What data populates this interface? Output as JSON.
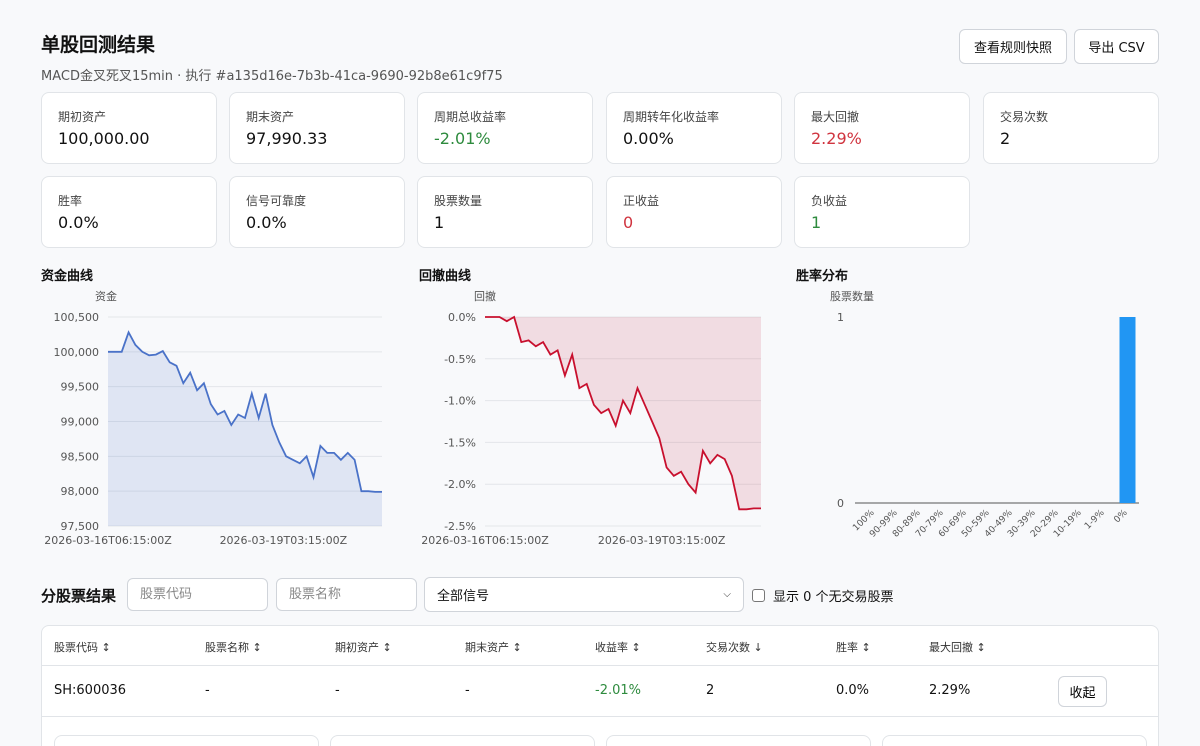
{
  "header": {
    "title": "单股回测结果",
    "subtitle": "MACD金叉死叉15min · 执行 #a135d16e-7b3b-41ca-9690-92b8e61c9f75"
  },
  "toolbar": {
    "rules_label": "查看规则快照",
    "csv_label": "导出 CSV"
  },
  "metrics": [
    {
      "label": "期初资产",
      "value": "100,000.00",
      "color": "#111111"
    },
    {
      "label": "期末资产",
      "value": "97,990.33",
      "color": "#111111"
    },
    {
      "label": "周期总收益率",
      "value": "-2.01%",
      "color": "#2e8b3e"
    },
    {
      "label": "周期转年化收益率",
      "value": "0.00%",
      "color": "#111111"
    },
    {
      "label": "最大回撤",
      "value": "2.29%",
      "color": "#d0343f"
    },
    {
      "label": "交易次数",
      "value": "2",
      "color": "#111111"
    },
    {
      "label": "胜率",
      "value": "0.0%",
      "color": "#111111"
    },
    {
      "label": "信号可靠度",
      "value": "0.0%",
      "color": "#111111"
    },
    {
      "label": "股票数量",
      "value": "1",
      "color": "#111111"
    },
    {
      "label": "正收益",
      "value": "0",
      "color": "#d0343f"
    },
    {
      "label": "负收益",
      "value": "1",
      "color": "#2e8b3e"
    }
  ],
  "charts": {
    "equity": {
      "title": "资金曲线"
    },
    "drawdown": {
      "title": "回撤曲线"
    },
    "winrate": {
      "title": "胜率分布"
    }
  },
  "chart_data": [
    {
      "type": "area",
      "title": "资金曲线",
      "ylabel": "资金",
      "ylim": [
        97500,
        100500
      ],
      "yticks": [
        "100,500",
        "100,000",
        "99,500",
        "99,000",
        "98,500",
        "98,000",
        "97,500"
      ],
      "xticks": [
        "2026-03-16T06:15:00Z",
        "2026-03-19T03:15:00Z"
      ],
      "color": "#4a72c8",
      "values": [
        100000,
        100000,
        100000,
        100280,
        100100,
        100000,
        99950,
        99960,
        100010,
        99850,
        99800,
        99550,
        99700,
        99450,
        99550,
        99250,
        99100,
        99150,
        98950,
        99100,
        99050,
        99400,
        99050,
        99400,
        98950,
        98700,
        98500,
        98450,
        98400,
        98500,
        98200,
        98650,
        98550,
        98550,
        98450,
        98550,
        98450,
        98000,
        98000,
        97990,
        97990
      ]
    },
    {
      "type": "area",
      "title": "回撤曲线",
      "ylabel": "回撤",
      "ylim": [
        -2.5,
        0
      ],
      "yticks": [
        "0.0%",
        "-0.5%",
        "-1.0%",
        "-1.5%",
        "-2.0%",
        "-2.5%"
      ],
      "xticks": [
        "2026-03-16T06:15:00Z",
        "2026-03-19T03:15:00Z"
      ],
      "color": "#c8102e",
      "values": [
        0,
        0,
        0,
        -0.05,
        0,
        -0.3,
        -0.28,
        -0.35,
        -0.3,
        -0.45,
        -0.4,
        -0.7,
        -0.45,
        -0.85,
        -0.8,
        -1.05,
        -1.15,
        -1.1,
        -1.3,
        -1.0,
        -1.15,
        -0.85,
        -1.05,
        -1.25,
        -1.45,
        -1.8,
        -1.9,
        -1.85,
        -2.0,
        -2.1,
        -1.6,
        -1.75,
        -1.65,
        -1.7,
        -1.9,
        -2.3,
        -2.3,
        -2.29,
        -2.29
      ]
    },
    {
      "type": "bar",
      "title": "胜率分布",
      "ylabel": "股票数量",
      "ylim": [
        0,
        1
      ],
      "yticks": [
        "1",
        "0"
      ],
      "categories": [
        "100%",
        "90-99%",
        "80-89%",
        "70-79%",
        "60-69%",
        "50-59%",
        "40-49%",
        "30-39%",
        "20-29%",
        "10-19%",
        "1-9%",
        "0%"
      ],
      "values": [
        0,
        0,
        0,
        0,
        0,
        0,
        0,
        0,
        0,
        0,
        0,
        1
      ],
      "color": "#2196f3"
    }
  ],
  "stocks": {
    "title": "分股票结果",
    "code_placeholder": "股票代码",
    "name_placeholder": "股票名称",
    "signal_selected": "全部信号",
    "show_no_trade_label": "显示 0 个无交易股票",
    "headers": [
      "股票代码 ↕",
      "股票名称 ↕",
      "期初资产 ↕",
      "期末资产 ↕",
      "收益率 ↕",
      "交易次数 ↓",
      "胜率 ↕",
      "最大回撤 ↕"
    ],
    "rows": [
      {
        "code": "SH:600036",
        "name": "-",
        "start": "-",
        "end": "-",
        "ret": "-2.01%",
        "trades": "2",
        "winrate": "0.0%",
        "maxdd": "2.29%",
        "action": "收起"
      }
    ]
  }
}
